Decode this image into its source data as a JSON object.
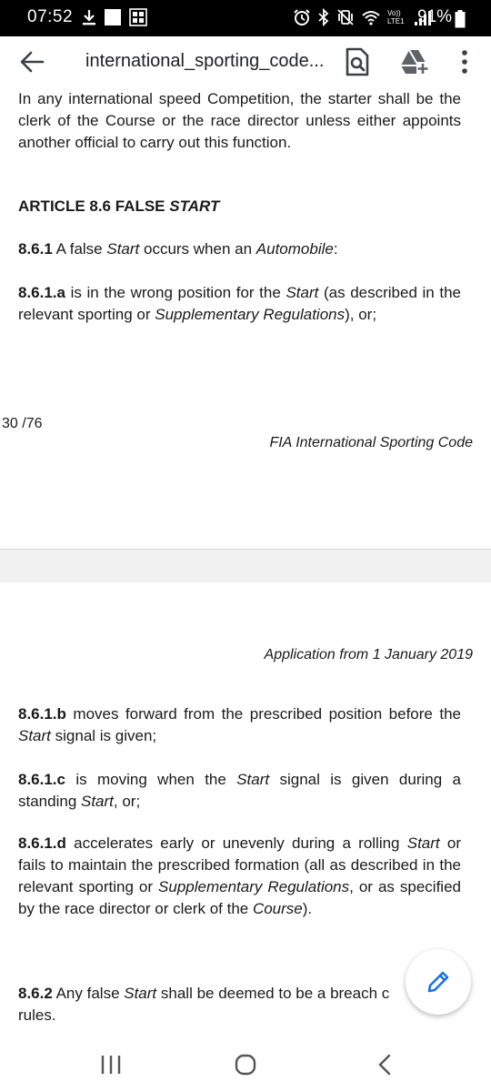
{
  "status_bar": {
    "time": "07:52",
    "battery": "91%",
    "network": "Vo)) LTE1"
  },
  "toolbar": {
    "title": "international_sporting_code...",
    "icons": [
      "back-arrow-icon",
      "find-in-document-icon",
      "add-to-drive-icon",
      "more-vert-icon"
    ]
  },
  "document": {
    "page1": {
      "intro": "In any international speed Competition, the starter shall be the clerk of the Course or the race director unless either appoints another official to carry out this function.",
      "heading_prefix": "ARTICLE 8.6 FALSE ",
      "heading_italic": "START",
      "p861_num": "8.6.1",
      "p861_a": " A false ",
      "p861_b": "Start",
      "p861_c": " occurs when an ",
      "p861_d": "Automobile",
      "p861_e": ":",
      "p861a_num": "8.6.1.a",
      "p861a_a": " is in the wrong position for the ",
      "p861a_b": "Start",
      "p861a_c": " (as described in the relevant sporting or ",
      "p861a_d": "Supplementary Regulations",
      "p861a_e": "), or;",
      "page_number": "30 /76",
      "footer": "FIA International Sporting Code"
    },
    "page2": {
      "header": "Application from 1 January 2019",
      "p861b_num": "8.6.1.b",
      "p861b_a": " moves forward from the prescribed position before the ",
      "p861b_b": "Start",
      "p861b_c": " signal is given;",
      "p861c_num": "8.6.1.c",
      "p861c_a": " is moving when the ",
      "p861c_b": "Start",
      "p861c_c": " signal is given during  a standing ",
      "p861c_d": "Start",
      "p861c_e": ", or;",
      "p861d_num": "8.6.1.d",
      "p861d_a": " accelerates early or unevenly during a rolling ",
      "p861d_b": "Start",
      "p861d_c": " or fails to maintain the prescribed formation (all as described in the relevant sporting or ",
      "p861d_d": "Supplementary Regulations",
      "p861d_e": ", or as specified by the race director or clerk of the ",
      "p861d_f": "Course",
      "p861d_g": ").",
      "p862_num": "8.6.2",
      "p862_a": " Any false ",
      "p862_b": "Start",
      "p862_c": " shall be deemed to be a breach c",
      "p862_d": "rules."
    }
  },
  "fab": {
    "icon": "edit-pencil-icon",
    "color": "#1a73e8"
  },
  "nav_bar": {
    "icons": [
      "recent-apps-icon",
      "home-icon",
      "back-icon"
    ]
  }
}
